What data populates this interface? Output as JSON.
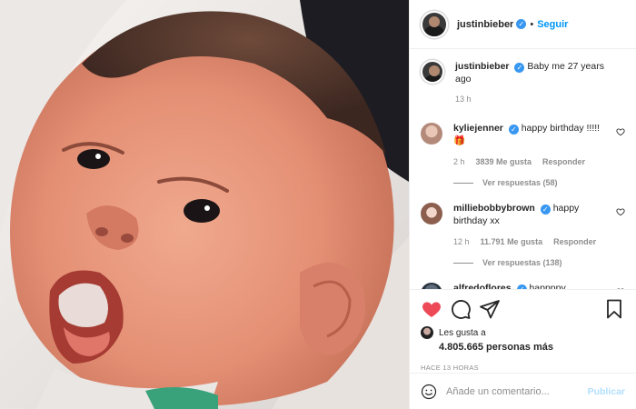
{
  "header": {
    "username": "justinbieber",
    "separator": "•",
    "follow_label": "Seguir"
  },
  "caption": {
    "username": "justinbieber",
    "text": "Baby me 27 years ago",
    "time": "13 h"
  },
  "comments": [
    {
      "username": "kyliejenner",
      "verified": true,
      "text": "happy birthday !!!!! 🎁",
      "time": "2 h",
      "likes": "3839 Me gusta",
      "reply_label": "Responder",
      "view_replies": "Ver respuestas (58)"
    },
    {
      "username": "milliebobbybrown",
      "verified": true,
      "text": "happy birthday xx",
      "time": "12 h",
      "likes": "11.791 Me gusta",
      "reply_label": "Responder",
      "view_replies": "Ver respuestas (138)"
    },
    {
      "username": "alfredoflores",
      "verified": true,
      "text": "happppy"
    }
  ],
  "likes": {
    "liked_by_prefix": "Les gusta a",
    "count_text": "4.805.665 personas más"
  },
  "post_time": "HACE 13 HORAS",
  "comment_box": {
    "placeholder": "Añade un comentario...",
    "publish_label": "Publicar"
  },
  "colors": {
    "accent": "#0095f6",
    "verified": "#3897f0",
    "liked_heart": "#ed4956",
    "publish_disabled": "#b2dffc",
    "muted": "#8e8e8e"
  },
  "icons": [
    "verified-badge-icon",
    "heart-icon",
    "comment-icon",
    "share-icon",
    "bookmark-icon",
    "emoji-icon"
  ]
}
